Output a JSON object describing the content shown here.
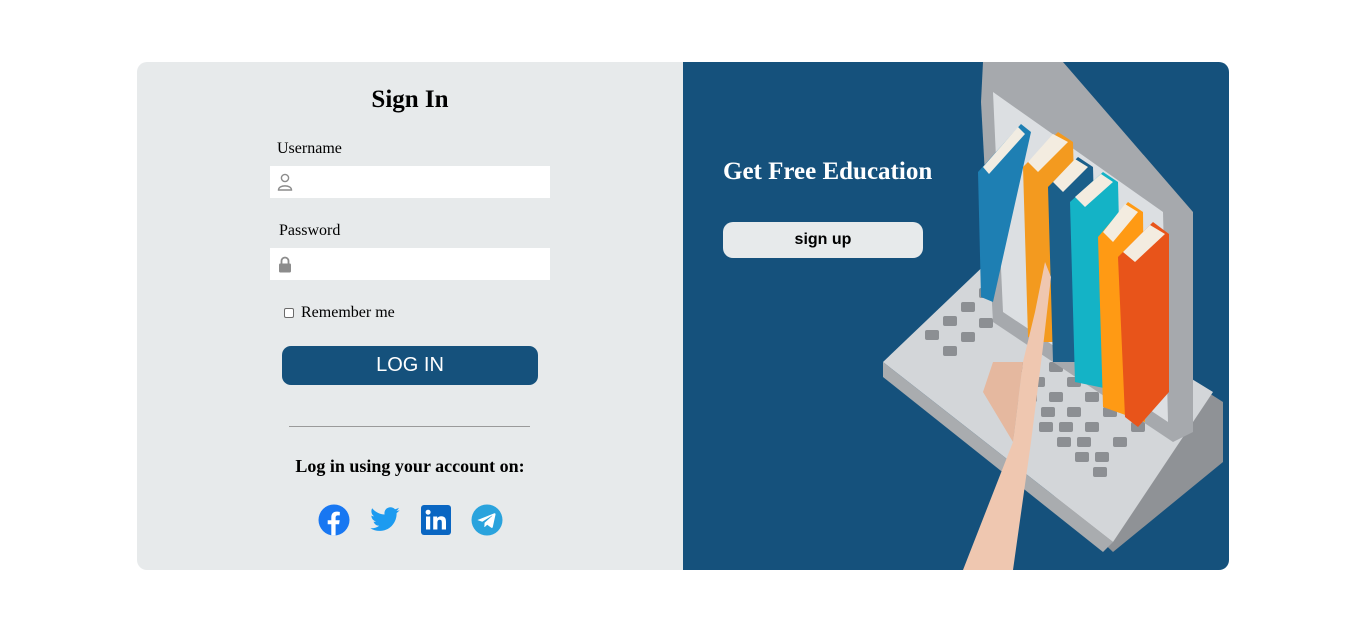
{
  "signin": {
    "title": "Sign In",
    "username_label": "Username",
    "username_value": "",
    "password_label": "Password",
    "password_value": "",
    "remember_label": "Remember me",
    "remember_checked": false,
    "login_label": "LOG IN",
    "social_title": "Log in using your account on:",
    "socials": [
      {
        "name": "facebook",
        "icon": "facebook-icon",
        "color": "#1877f2"
      },
      {
        "name": "twitter",
        "icon": "twitter-icon",
        "color": "#1d9bf0"
      },
      {
        "name": "linkedin",
        "icon": "linkedin-icon",
        "color": "#0a66c2"
      },
      {
        "name": "telegram",
        "icon": "telegram-icon",
        "color": "#2aa3dd"
      }
    ]
  },
  "promo": {
    "title": "Get Free Education",
    "signup_label": "sign up"
  },
  "colors": {
    "primary": "#15517c",
    "panel": "#e7eaeb"
  },
  "icons": {
    "username": "user-icon",
    "password": "lock-icon",
    "illustration": "laptop-books-hand-illustration"
  }
}
